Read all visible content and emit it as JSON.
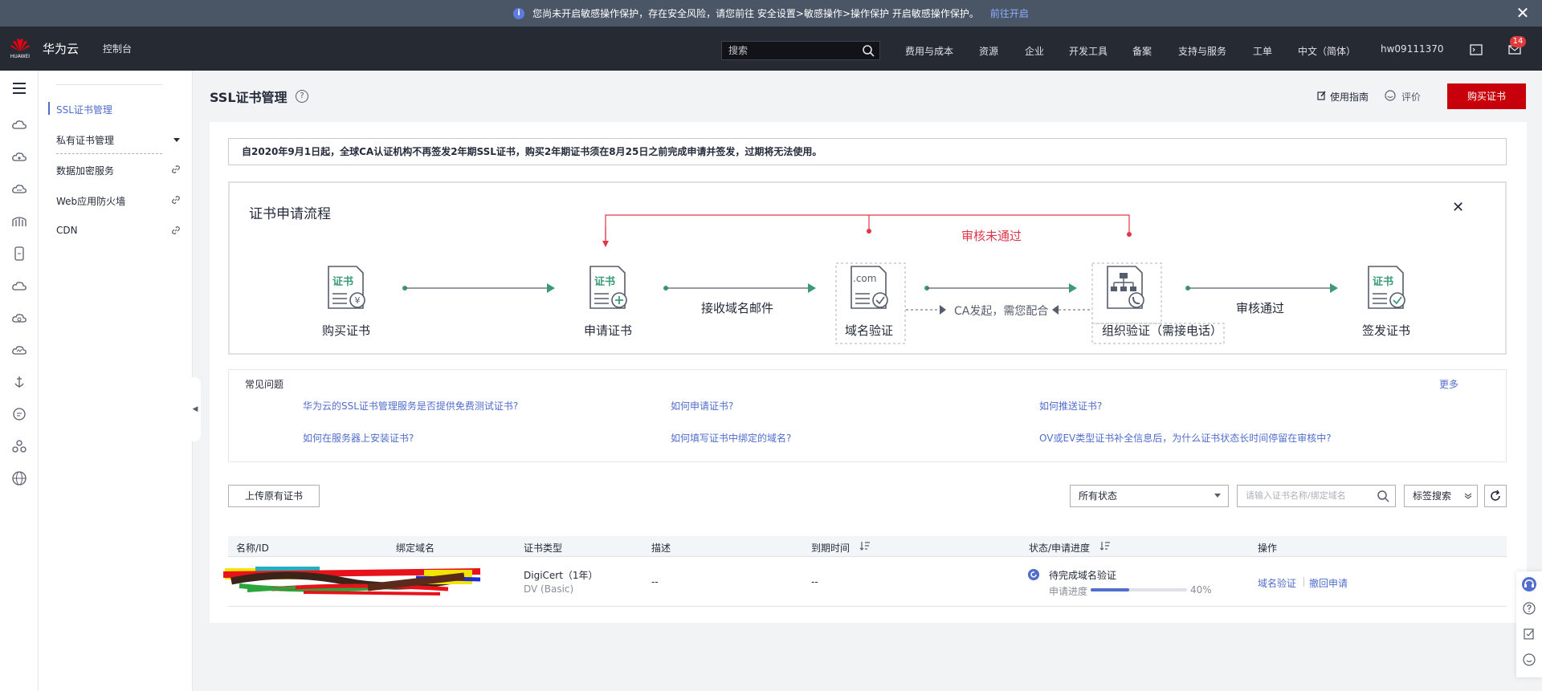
{
  "notice": {
    "text": "您尚未开启敏感操作保护，存在安全风险，请您前往 安全设置>敏感操作>操作保护 开启敏感操作保护。",
    "link": "前往开启"
  },
  "header": {
    "logo_text": "HUAWEI",
    "brand": "华为云",
    "console": "控制台",
    "search_placeholder": "搜索",
    "nav": [
      "费用与成本",
      "资源",
      "企业",
      "开发工具",
      "备案",
      "支持与服务",
      "工单",
      "中文（简体）",
      "hw09111370"
    ],
    "message_count": "14"
  },
  "sidebar": {
    "items": [
      {
        "label": "SSL证书管理"
      },
      {
        "label": "私有证书管理"
      },
      {
        "label": "数据加密服务"
      },
      {
        "label": "Web应用防火墙"
      },
      {
        "label": "CDN"
      }
    ]
  },
  "page": {
    "title": "SSL证书管理",
    "guide": "使用指南",
    "rate": "评价",
    "buy": "购买证书"
  },
  "announcement": "自2020年9月1日起，全球CA认证机构不再签发2年期SSL证书，购买2年期证书须在8月25日之前完成申请并签发，过期将无法使用。",
  "flow": {
    "title": "证书申请流程",
    "steps": [
      "购买证书",
      "申请证书",
      "域名验证",
      "组织验证（需接电话）",
      "签发证书"
    ],
    "arrows": [
      "接收域名邮件",
      "CA发起，需您配合",
      "审核通过"
    ],
    "reject": "审核未通过",
    "icon_texts": {
      "cert": "证书",
      "com": ".com"
    }
  },
  "faq": {
    "title": "常见问题",
    "more": "更多",
    "questions": [
      "华为云的SSL证书管理服务是否提供免费测试证书?",
      "如何申请证书?",
      "如何推送证书?",
      "如何在服务器上安装证书?",
      "如何填写证书中绑定的域名?",
      "OV或EV类型证书补全信息后，为什么证书状态长时间停留在审核中?"
    ]
  },
  "toolbar": {
    "upload": "上传原有证书",
    "status_select": "所有状态",
    "search_placeholder": "请输入证书名称/绑定域名",
    "tag_search": "标签搜索"
  },
  "table": {
    "columns": [
      "名称/ID",
      "绑定域名",
      "证书类型",
      "描述",
      "到期时间",
      "状态/申请进度",
      "操作"
    ],
    "rows": [
      {
        "cert_type": "DigiCert（1年）",
        "cert_level": "DV (Basic)",
        "desc": "--",
        "expire": "--",
        "status": "待完成域名验证",
        "progress_label": "申请进度",
        "progress_pct": "40%",
        "progress": 0.4,
        "ops": [
          "域名验证",
          "撤回申请"
        ]
      }
    ]
  },
  "colors": {
    "brand_red": "#c7000b",
    "link_blue": "#526ecc",
    "reject_red": "#e0364a",
    "flow_green": "#3c9a78"
  }
}
